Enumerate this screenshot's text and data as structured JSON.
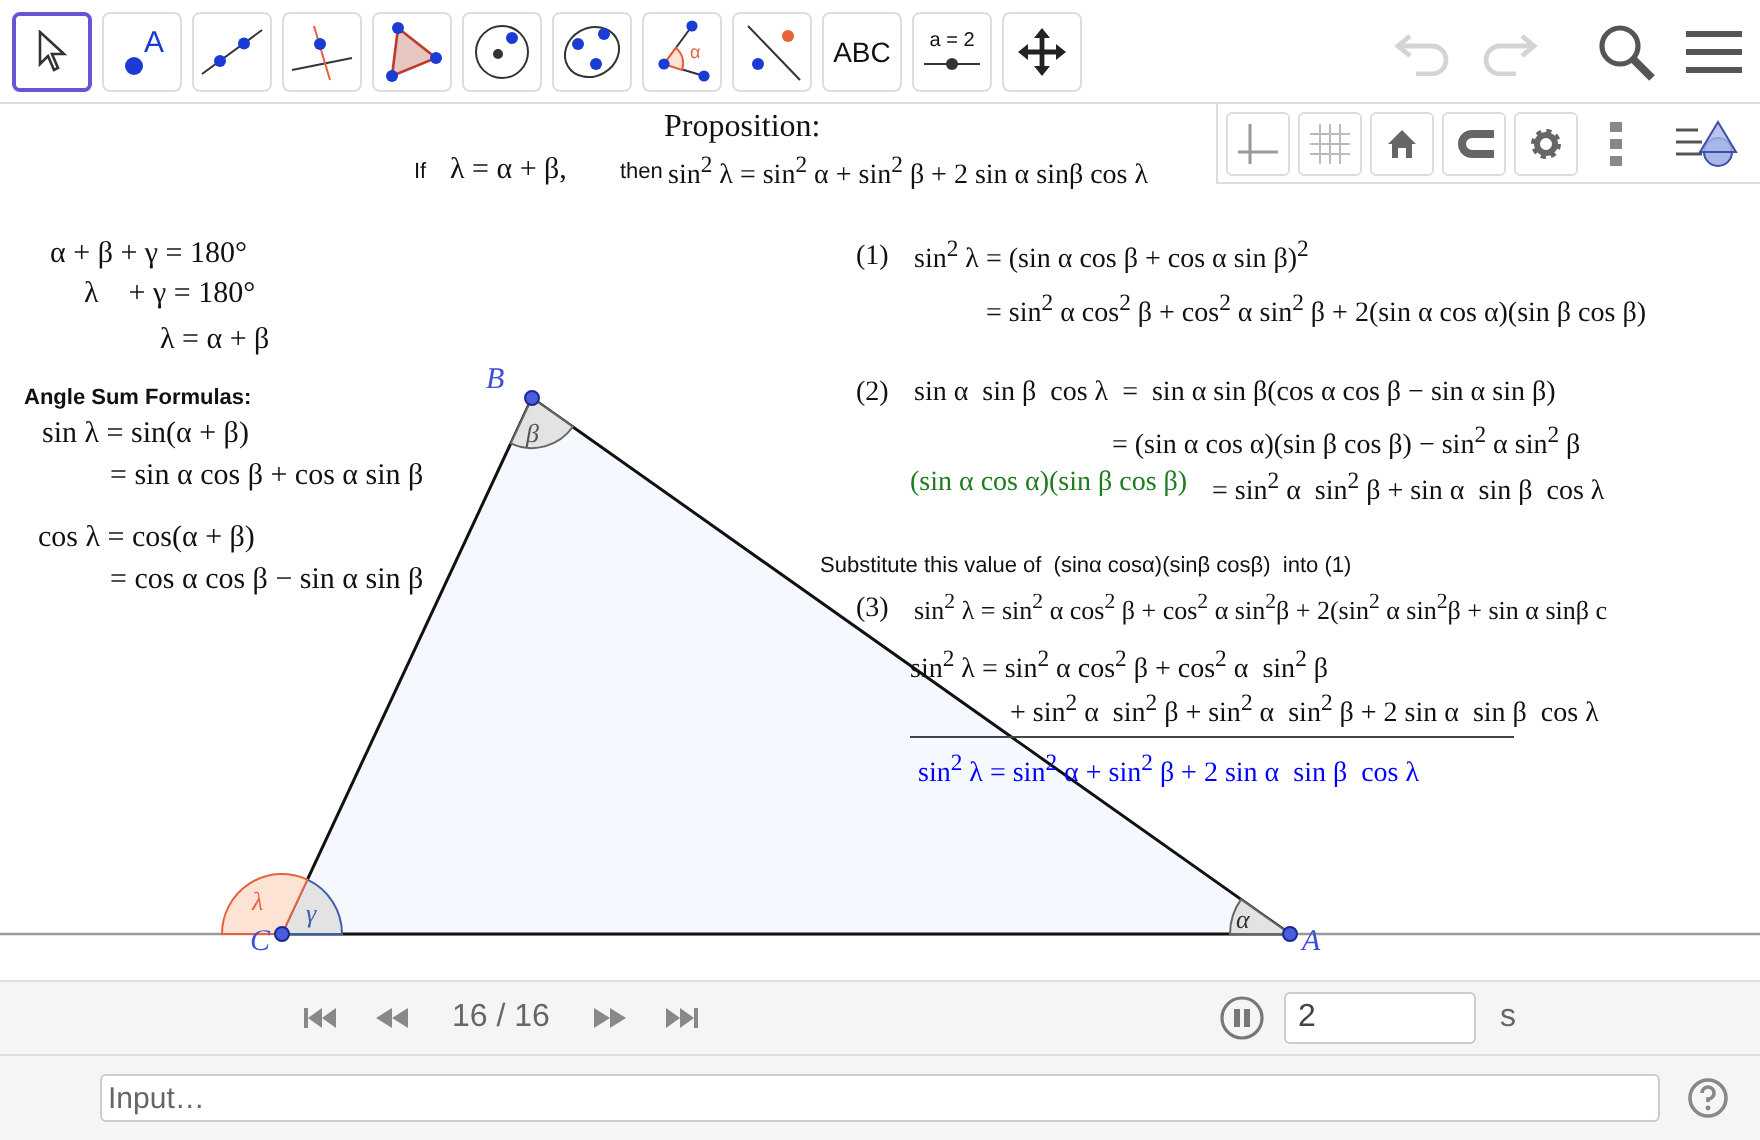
{
  "toolbar": {
    "tools": [
      {
        "kind": "move",
        "selected": true
      },
      {
        "kind": "point",
        "selected": false,
        "label": "A"
      },
      {
        "kind": "line",
        "selected": false
      },
      {
        "kind": "perpendicular",
        "selected": false
      },
      {
        "kind": "polygon",
        "selected": false
      },
      {
        "kind": "circle",
        "selected": false
      },
      {
        "kind": "conic",
        "selected": false
      },
      {
        "kind": "angle",
        "selected": false,
        "label": "α"
      },
      {
        "kind": "reflect",
        "selected": false
      },
      {
        "kind": "text",
        "selected": false,
        "label": "ABC"
      },
      {
        "kind": "slider",
        "selected": false,
        "label": "a = 2"
      },
      {
        "kind": "pan",
        "selected": false
      }
    ],
    "actions": [
      {
        "kind": "undo",
        "disabled": true
      },
      {
        "kind": "redo",
        "disabled": true
      },
      {
        "kind": "search",
        "disabled": false
      },
      {
        "kind": "menu",
        "disabled": false
      }
    ]
  },
  "style_bar": [
    {
      "kind": "axes"
    },
    {
      "kind": "grid"
    },
    {
      "kind": "home"
    },
    {
      "kind": "magnet"
    },
    {
      "kind": "settings"
    },
    {
      "kind": "more"
    },
    {
      "kind": "views"
    }
  ],
  "canvas": {
    "texts": [
      {
        "kind": "heading",
        "text": "Proposition:"
      },
      {
        "kind": "note",
        "text": "If"
      },
      {
        "kind": "math",
        "text": "λ = α + β,"
      },
      {
        "kind": "note",
        "text": "then"
      },
      {
        "kind": "math",
        "text": "sin$^{2}$ λ = sin$^{2}$ α + sin$^{2}$ β + 2 sin α sinβ cos λ"
      },
      {
        "kind": "math",
        "text": "α + β + γ = 180°"
      },
      {
        "kind": "math",
        "text": "λ    + γ = 180°"
      },
      {
        "kind": "math",
        "text": "λ = α + β"
      },
      {
        "kind": "label",
        "text": "Angle Sum Formulas:"
      },
      {
        "kind": "math",
        "text": "sin λ = sin(α + β)"
      },
      {
        "kind": "math",
        "text": "= sin α cos β + cos α sin β"
      },
      {
        "kind": "math",
        "text": "cos λ = cos(α + β)"
      },
      {
        "kind": "math",
        "text": "= cos α cos β − sin α sin β"
      },
      {
        "kind": "math",
        "text": "(1)"
      },
      {
        "kind": "math",
        "text": "sin$^{2}$ λ = (sin α cos β + cos α sin β)$^{2}$"
      },
      {
        "kind": "math",
        "text": "= sin$^{2}$ α cos$^{2}$ β + cos$^{2}$ α sin$^{2}$ β + 2(sin α cos α)(sin β cos β)"
      },
      {
        "kind": "math",
        "text": "(2)"
      },
      {
        "kind": "math",
        "text": "sin α  sin β  cos λ  =  sin α sin β(cos α cos β − sin α sin β)"
      },
      {
        "kind": "math",
        "text": "= (sin α cos α)(sin β cos β) − sin$^{2}$ α sin$^{2}$ β"
      },
      {
        "kind": "math",
        "text": "(sin α cos α)(sin β cos β)",
        "color": "#1e7b1e"
      },
      {
        "kind": "math",
        "text": "= sin$^{2}$ α  sin$^{2}$ β + sin α  sin β  cos λ"
      },
      {
        "kind": "note",
        "text": "Substitute this value of  (sinα cosα)(sinβ cosβ)  into (1)"
      },
      {
        "kind": "math",
        "text": "(3)"
      },
      {
        "kind": "math",
        "text": "sin$^{2}$ λ = sin$^{2}$ α cos$^{2}$ β + cos$^{2}$ α sin$^{2}$β + 2(sin$^{2}$ α sin$^{2}$β + sin α sinβ c"
      },
      {
        "kind": "math",
        "text": "sin$^{2}$ λ = sin$^{2}$ α cos$^{2}$ β + cos$^{2}$ α  sin$^{2}$ β"
      },
      {
        "kind": "math",
        "text": "+ sin$^{2}$ α  sin$^{2}$ β + sin$^{2}$ α  sin$^{2}$ β + 2 sin α  sin β  cos λ"
      },
      {
        "kind": "rule"
      },
      {
        "kind": "math",
        "text": "sin$^{2}$ λ = sin$^{2}$ α + sin$^{2}$ β + 2 sin α  sin β  cos λ",
        "color": "#0000ff"
      }
    ],
    "triangle": {
      "vertices": [
        {
          "label": "B"
        },
        {
          "label": "C"
        },
        {
          "label": "A"
        }
      ],
      "angles": [
        {
          "label": "β"
        },
        {
          "label": "γ"
        },
        {
          "label": "α"
        },
        {
          "label": "λ"
        }
      ]
    }
  },
  "animation": {
    "frame": "16 / 16",
    "playing": true,
    "speed": "2",
    "unit": "s"
  },
  "input_bar": {
    "placeholder": "Input…"
  }
}
